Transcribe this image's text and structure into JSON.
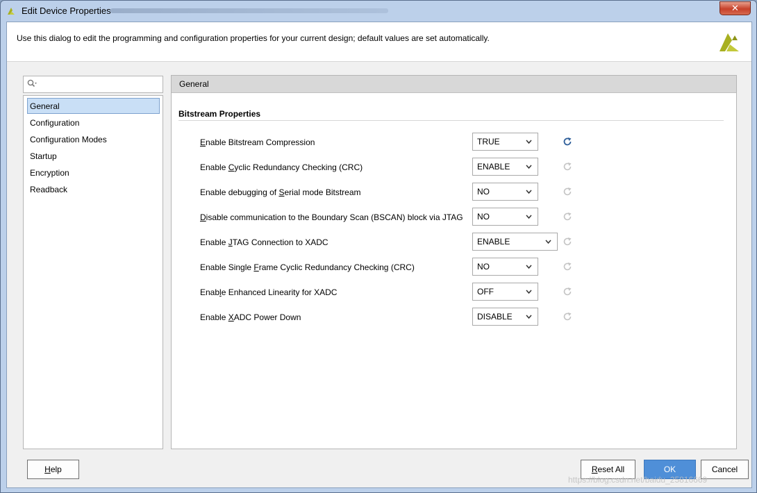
{
  "window": {
    "title": "Edit Device Properties",
    "close_label": "✕"
  },
  "header": {
    "description": "Use this dialog to edit the programming and configuration properties for your current design; default values are set automatically."
  },
  "search": {
    "placeholder": ""
  },
  "nav": {
    "items": [
      {
        "label": "General",
        "selected": true
      },
      {
        "label": "Configuration",
        "selected": false
      },
      {
        "label": "Configuration Modes",
        "selected": false
      },
      {
        "label": "Startup",
        "selected": false
      },
      {
        "label": "Encryption",
        "selected": false
      },
      {
        "label": "Readback",
        "selected": false
      }
    ]
  },
  "content": {
    "heading": "General",
    "section_title": "Bitstream Properties",
    "properties": [
      {
        "pre": "",
        "mn": "E",
        "post": "nable Bitstream Compression",
        "value": "TRUE",
        "reset_active": true
      },
      {
        "pre": "Enable ",
        "mn": "C",
        "post": "yclic Redundancy Checking (CRC)",
        "value": "ENABLE",
        "reset_active": false
      },
      {
        "pre": "Enable debugging of ",
        "mn": "S",
        "post": "erial mode Bitstream",
        "value": "NO",
        "reset_active": false
      },
      {
        "pre": "",
        "mn": "D",
        "post": "isable communication to the Boundary Scan (BSCAN) block via JTAG",
        "value": "NO",
        "reset_active": false
      },
      {
        "pre": "Enable ",
        "mn": "J",
        "post": "TAG Connection to XADC",
        "value": "ENABLE",
        "reset_active": false
      },
      {
        "pre": "Enable Single ",
        "mn": "F",
        "post": "rame Cyclic Redundancy Checking (CRC)",
        "value": "NO",
        "reset_active": false
      },
      {
        "pre": "Enab",
        "mn": "l",
        "post": "e Enhanced Linearity for XADC",
        "value": "OFF",
        "reset_active": false
      },
      {
        "pre": "Enable ",
        "mn": "X",
        "post": "ADC Power Down",
        "value": "DISABLE",
        "reset_active": false
      }
    ]
  },
  "footer": {
    "help_mn": "H",
    "help_rest": "elp",
    "reset_mn": "R",
    "reset_rest": "eset All",
    "ok_label": "OK",
    "cancel_label": "Cancel"
  },
  "watermark": "https://blog.csdn.net/baidu_25816669",
  "colors": {
    "accent": "#4f8fd8",
    "selection": "#c9dff6",
    "reset_active": "#2f5f9a",
    "reset_inactive": "#c4c4c4",
    "logo": "#a8b020"
  },
  "icons": {
    "title": "xilinx-logo-icon",
    "search": "search-icon",
    "combo": "chevron-down-icon",
    "reset": "reset-default-icon"
  }
}
